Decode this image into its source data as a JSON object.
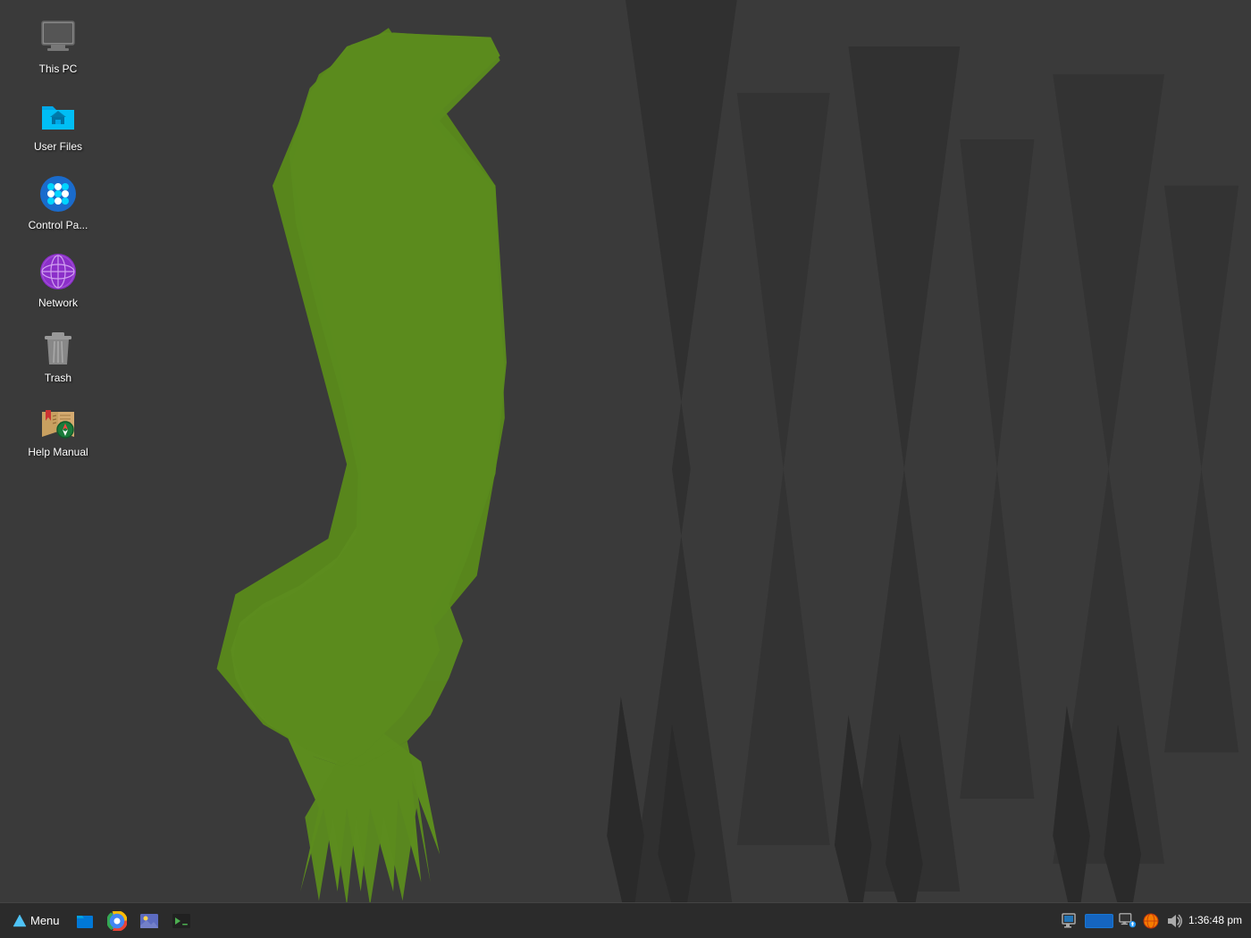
{
  "desktop": {
    "background_color": "#3c3c3c"
  },
  "icons": [
    {
      "id": "this-pc",
      "label": "This PC",
      "type": "computer"
    },
    {
      "id": "user-files",
      "label": "User Files",
      "type": "folder"
    },
    {
      "id": "control-panel",
      "label": "Control Pa...",
      "type": "control-panel"
    },
    {
      "id": "network",
      "label": "Network",
      "type": "network"
    },
    {
      "id": "trash",
      "label": "Trash",
      "type": "trash"
    },
    {
      "id": "help-manual",
      "label": "Help Manual",
      "type": "help"
    }
  ],
  "taskbar": {
    "menu_label": "Menu",
    "clock_time": "1:36:48 pm",
    "apps": [
      {
        "id": "files",
        "type": "files"
      },
      {
        "id": "chrome",
        "type": "chrome"
      },
      {
        "id": "images",
        "type": "images"
      },
      {
        "id": "terminal",
        "type": "terminal"
      }
    ]
  }
}
